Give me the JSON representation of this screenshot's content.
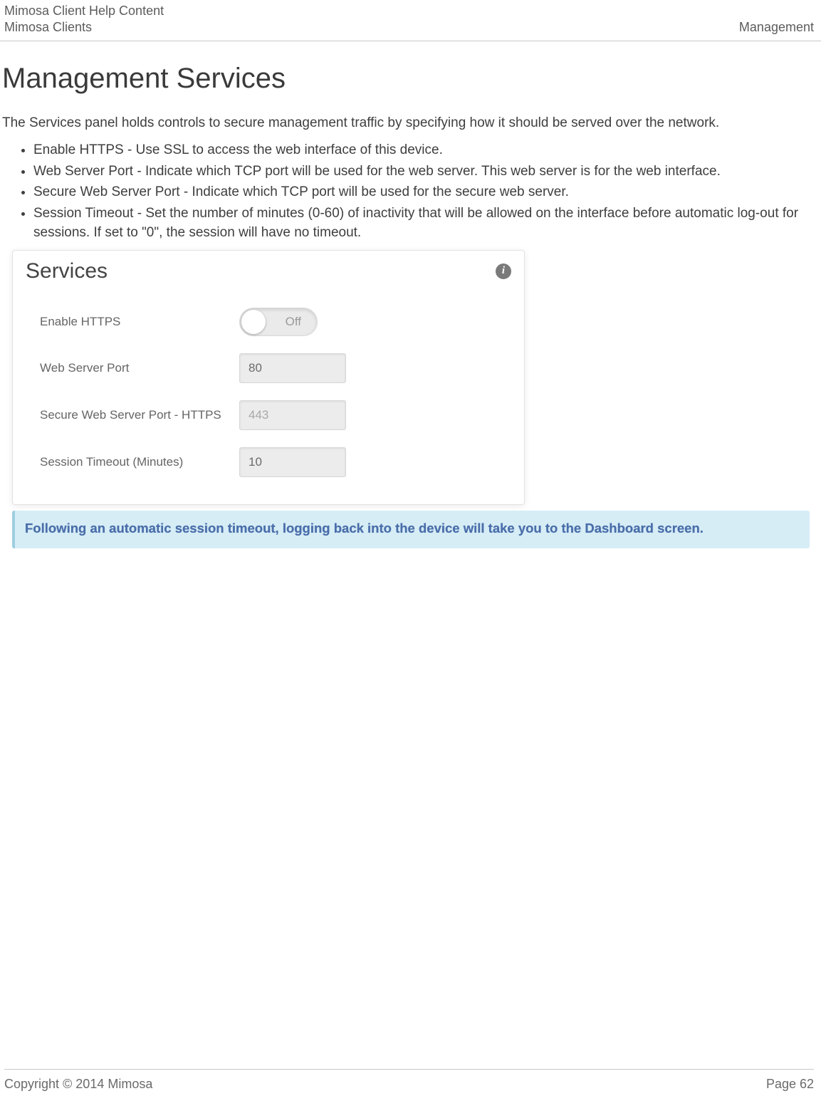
{
  "header": {
    "line1": "Mimosa Client Help Content",
    "line2": "Mimosa Clients",
    "right": "Management"
  },
  "title": "Management Services",
  "intro": "The Services panel holds controls to secure management traffic by specifying how it should be served over the network.",
  "bullets": [
    "Enable HTTPS - Use SSL to access the web interface of this device.",
    "Web Server Port - Indicate which TCP port will be used for the web server. This web server is for the web interface.",
    "Secure Web Server Port - Indicate which TCP port will be used for the secure web server.",
    "Session Timeout - Set the number of minutes (0-60) of inactivity that will be allowed on the interface before automatic log-out for sessions. If set to \"0\", the session will have no timeout."
  ],
  "panel": {
    "title": "Services",
    "info_glyph": "i",
    "rows": {
      "enable_https_label": "Enable HTTPS",
      "enable_https_state": "Off",
      "web_port_label": "Web Server Port",
      "web_port_value": "80",
      "secure_port_label": "Secure Web Server Port - HTTPS",
      "secure_port_value": "443",
      "timeout_label": "Session Timeout (Minutes)",
      "timeout_value": "10"
    }
  },
  "note": "Following an automatic session timeout, logging back into the device will take you to the Dashboard screen.",
  "footer": {
    "left": "Copyright © 2014 Mimosa",
    "right": "Page 62"
  }
}
